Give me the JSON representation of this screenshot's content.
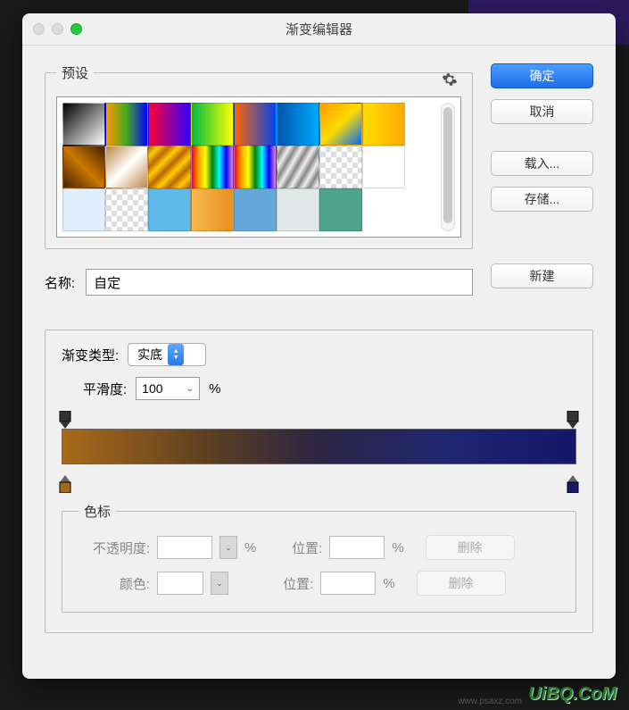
{
  "window": {
    "title": "渐变编辑器"
  },
  "presets": {
    "legend": "预设",
    "swatches": [
      {
        "bg": "linear-gradient(135deg,#000,#fff)"
      },
      {
        "bg": "linear-gradient(90deg,#ff9a00,#4a2,#00f)"
      },
      {
        "bg": "linear-gradient(90deg,#f03,#30f)"
      },
      {
        "bg": "linear-gradient(90deg,#0b4,#ff0)"
      },
      {
        "bg": "linear-gradient(90deg,#f60,#04e)"
      },
      {
        "bg": "linear-gradient(90deg,#05a,#0af)"
      },
      {
        "bg": "linear-gradient(135deg,#f90,#fd0,#06f)"
      },
      {
        "bg": "linear-gradient(90deg,#fd0,#fa0)"
      },
      {
        "bg": "linear-gradient(45deg,#420,#c70,#420)"
      },
      {
        "bg": "linear-gradient(135deg,#b84,#fff,#b84)"
      },
      {
        "bg": "repeating-linear-gradient(135deg,#b60,#fc0 8px,#b60 16px)"
      },
      {
        "bg": "linear-gradient(90deg,red,orange,yellow,green,cyan,blue,violet)"
      },
      {
        "bg": "linear-gradient(90deg,red,orange,yellow,green,cyan,blue,violet)"
      },
      {
        "bg": "repeating-linear-gradient(120deg,#eee,#888 6px,#eee 12px)"
      },
      {
        "checker": true
      },
      {
        "bg": "linear-gradient(#fff,#fff)"
      },
      {
        "bg": "linear-gradient(#dfeffd,#dfeffd)"
      },
      {
        "checker": true
      },
      {
        "bg": "linear-gradient(#5fb9e8,#5fb9e8)"
      },
      {
        "bg": "linear-gradient(90deg,#f7b94d,#e98f1f)"
      },
      {
        "bg": "linear-gradient(#63a8d8,#63a8d8)"
      },
      {
        "bg": "linear-gradient(#e0e9e7,#e0e9e7)"
      },
      {
        "bg": "linear-gradient(#4fa58c,#4fa58c)"
      },
      {
        "blank": true
      }
    ]
  },
  "buttons": {
    "ok": "确定",
    "cancel": "取消",
    "load": "载入...",
    "save": "存储...",
    "new": "新建",
    "delete": "删除"
  },
  "name": {
    "label": "名称:",
    "value": "自定"
  },
  "gradient": {
    "type_label": "渐变类型:",
    "type_value": "实底",
    "smooth_label": "平滑度:",
    "smooth_value": "100",
    "pct": "%"
  },
  "stops": {
    "legend": "色标",
    "opacity_label": "不透明度:",
    "color_label": "颜色:",
    "position_label": "位置:",
    "pct": "%"
  },
  "watermark": {
    "main": "UiBQ.CoM",
    "sub": "www.psaxz.com"
  }
}
